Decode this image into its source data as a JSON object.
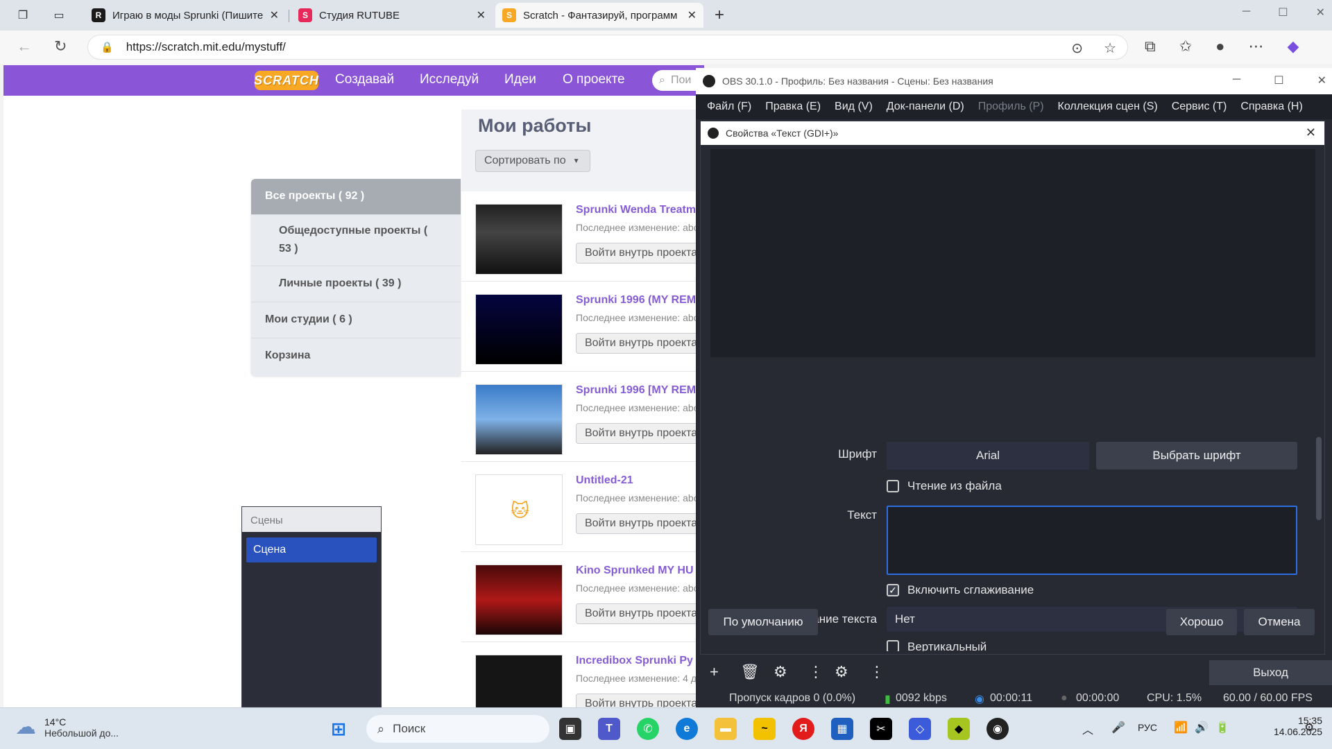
{
  "browser": {
    "tabs": [
      {
        "title": "Играю в моды Sprunki (Пишите"
      },
      {
        "title": "Студия RUTUBE"
      },
      {
        "title": "Scratch - Фантазируй, программ"
      }
    ],
    "url": "https://scratch.mit.edu/mystuff/"
  },
  "scratch": {
    "logo": "SCRATCH",
    "nav": [
      "Создавай",
      "Исследуй",
      "Идеи",
      "О проекте"
    ],
    "search_placeholder": "Пои",
    "title": "Мои работы",
    "sort_label": "Сортировать по",
    "sidebar": [
      {
        "label": "Все проекты ( 92 )"
      },
      {
        "label": "Общедоступные проекты ("
      },
      {
        "label": "53 )"
      },
      {
        "label": "Личные проекты ( 39 )"
      },
      {
        "label": "Мои студии ( 6 )"
      },
      {
        "label": "Корзина"
      }
    ],
    "projects": [
      {
        "name": "Sprunki Wenda Treatm",
        "date": "Последнее изменение: abo",
        "button": "Войти внутрь проекта"
      },
      {
        "name": "Sprunki 1996 (MY REM",
        "date": "Последнее изменение: abo",
        "button": "Войти внутрь проекта"
      },
      {
        "name": "Sprunki 1996 [MY REM",
        "date": "Последнее изменение: abo",
        "button": "Войти внутрь проекта"
      },
      {
        "name": "Untitled-21",
        "date": "Последнее изменение: abo",
        "button": "Войти внутрь проекта"
      },
      {
        "name": "Kino Sprunked MY HU",
        "date": "Последнее изменение: abo",
        "button": "Войти внутрь проекта"
      },
      {
        "name": "Incredibox Sprunki Py",
        "date": "Последнее изменение: 4 д",
        "button": "Войти внутрь проекта"
      }
    ]
  },
  "scenes_dock": {
    "header": "Сцены",
    "item": "Сцена"
  },
  "obs": {
    "title": "OBS 30.1.0 - Профиль: Без названия - Сцены: Без названия",
    "menu": [
      {
        "label": "Файл (F)"
      },
      {
        "label": "Правка (E)"
      },
      {
        "label": "Вид (V)"
      },
      {
        "label": "Док-панели (D)"
      },
      {
        "label": "Профиль (P)"
      },
      {
        "label": "Коллекция сцен (S)"
      },
      {
        "label": "Сервис (T)"
      },
      {
        "label": "Справка (H)"
      }
    ],
    "props": {
      "title": "Свойства «Текст (GDI+)»",
      "font_label": "Шрифт",
      "font_value": "Arial",
      "choose_font": "Выбрать шрифт",
      "read_from_file": "Чтение из файла",
      "read_from_file_checked": false,
      "text_label": "Текст",
      "text_value": "",
      "antialias": "Включить сглаживание",
      "antialias_checked": true,
      "transform_label": "Преобразование текста",
      "transform_value": "Нет",
      "vertical": "Вертикальный",
      "defaults_btn": "По умолчанию",
      "ok_btn": "Хорошо",
      "cancel_btn": "Отмена"
    },
    "exit_btn": "Выход",
    "status": {
      "dropped": "Пропуск кадров 0 (0.0%)",
      "bitrate": "0092 kbps",
      "stream_time": "00:00:11",
      "rec_time": "00:00:00",
      "cpu": "CPU: 1.5%",
      "fps": "60.00 / 60.00 FPS"
    }
  },
  "taskbar": {
    "temp": "14°C",
    "weather": "Небольшой до...",
    "search": "Поиск",
    "lang": "РУС",
    "time": "15:35",
    "date": "14.06.2025"
  },
  "colors": {
    "scratch_purple": "#8a55d7",
    "obs_dark": "#272a33",
    "accent_blue": "#2a52be"
  }
}
